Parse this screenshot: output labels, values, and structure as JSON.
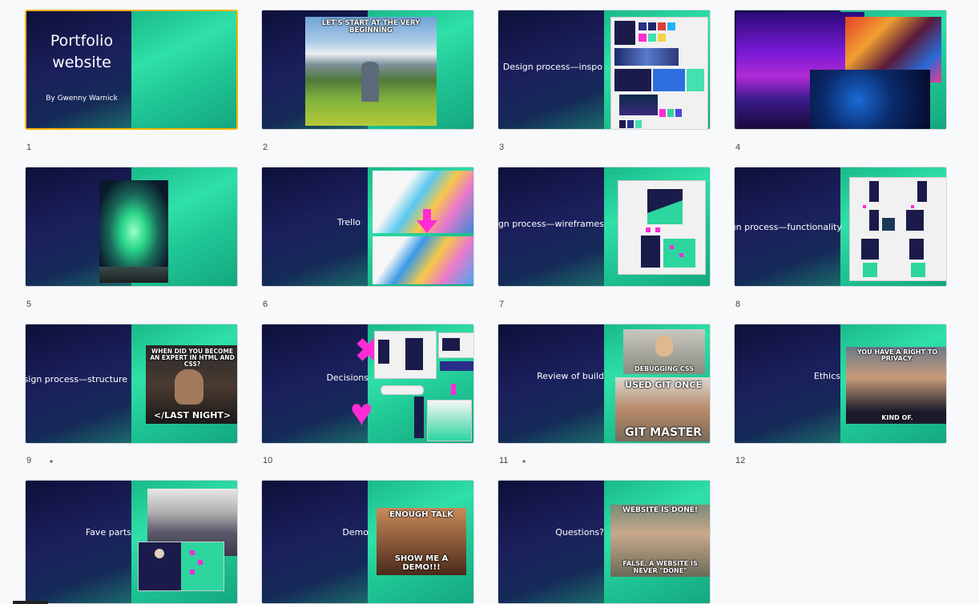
{
  "slides": [
    {
      "number": "1",
      "title": "Portfolio website",
      "subtitle": "By Gwenny Warnick",
      "selected": true
    },
    {
      "number": "2",
      "meme_text": "LET'S START AT THE VERY BEGINNING"
    },
    {
      "number": "3",
      "title": "Design process—inspo"
    },
    {
      "number": "4"
    },
    {
      "number": "5"
    },
    {
      "number": "6",
      "title": "Trello"
    },
    {
      "number": "7",
      "title": "Design process—wireframes"
    },
    {
      "number": "8",
      "title": "Design process—functionality"
    },
    {
      "number": "9",
      "title": "Design process—structure",
      "meme_top": "WHEN DID YOU BECOME AN EXPERT IN HTML AND CSS?",
      "meme_bottom": "</LAST NIGHT>"
    },
    {
      "number": "10",
      "title": "Decisions"
    },
    {
      "number": "11",
      "title": "Review of build",
      "meme_a": "DEBUGGING CSS",
      "meme_b_top": "USED GIT ONCE",
      "meme_b_bottom": "GIT MASTER"
    },
    {
      "number": "12",
      "title": "Ethics",
      "meme_top": "YOU HAVE A RIGHT TO PRIVACY.",
      "meme_bottom": "KIND OF."
    },
    {
      "number": "",
      "title": "Fave parts"
    },
    {
      "number": "",
      "title": "Demo",
      "meme_top": "ENOUGH TALK",
      "meme_bottom": "SHOW ME A DEMO!!!"
    },
    {
      "number": "",
      "title": "Questions?",
      "meme_top": "WEBSITE IS DONE!",
      "meme_bottom": "FALSE. A WEBSITE IS NEVER \"DONE\""
    }
  ],
  "colors": {
    "accent_selected": "#f4b400",
    "slide_dark": "#12164a",
    "slide_green": "#2fe0a8",
    "magenta": "#ff2bd6"
  },
  "icons": {
    "linked_slide": "link-icon"
  }
}
